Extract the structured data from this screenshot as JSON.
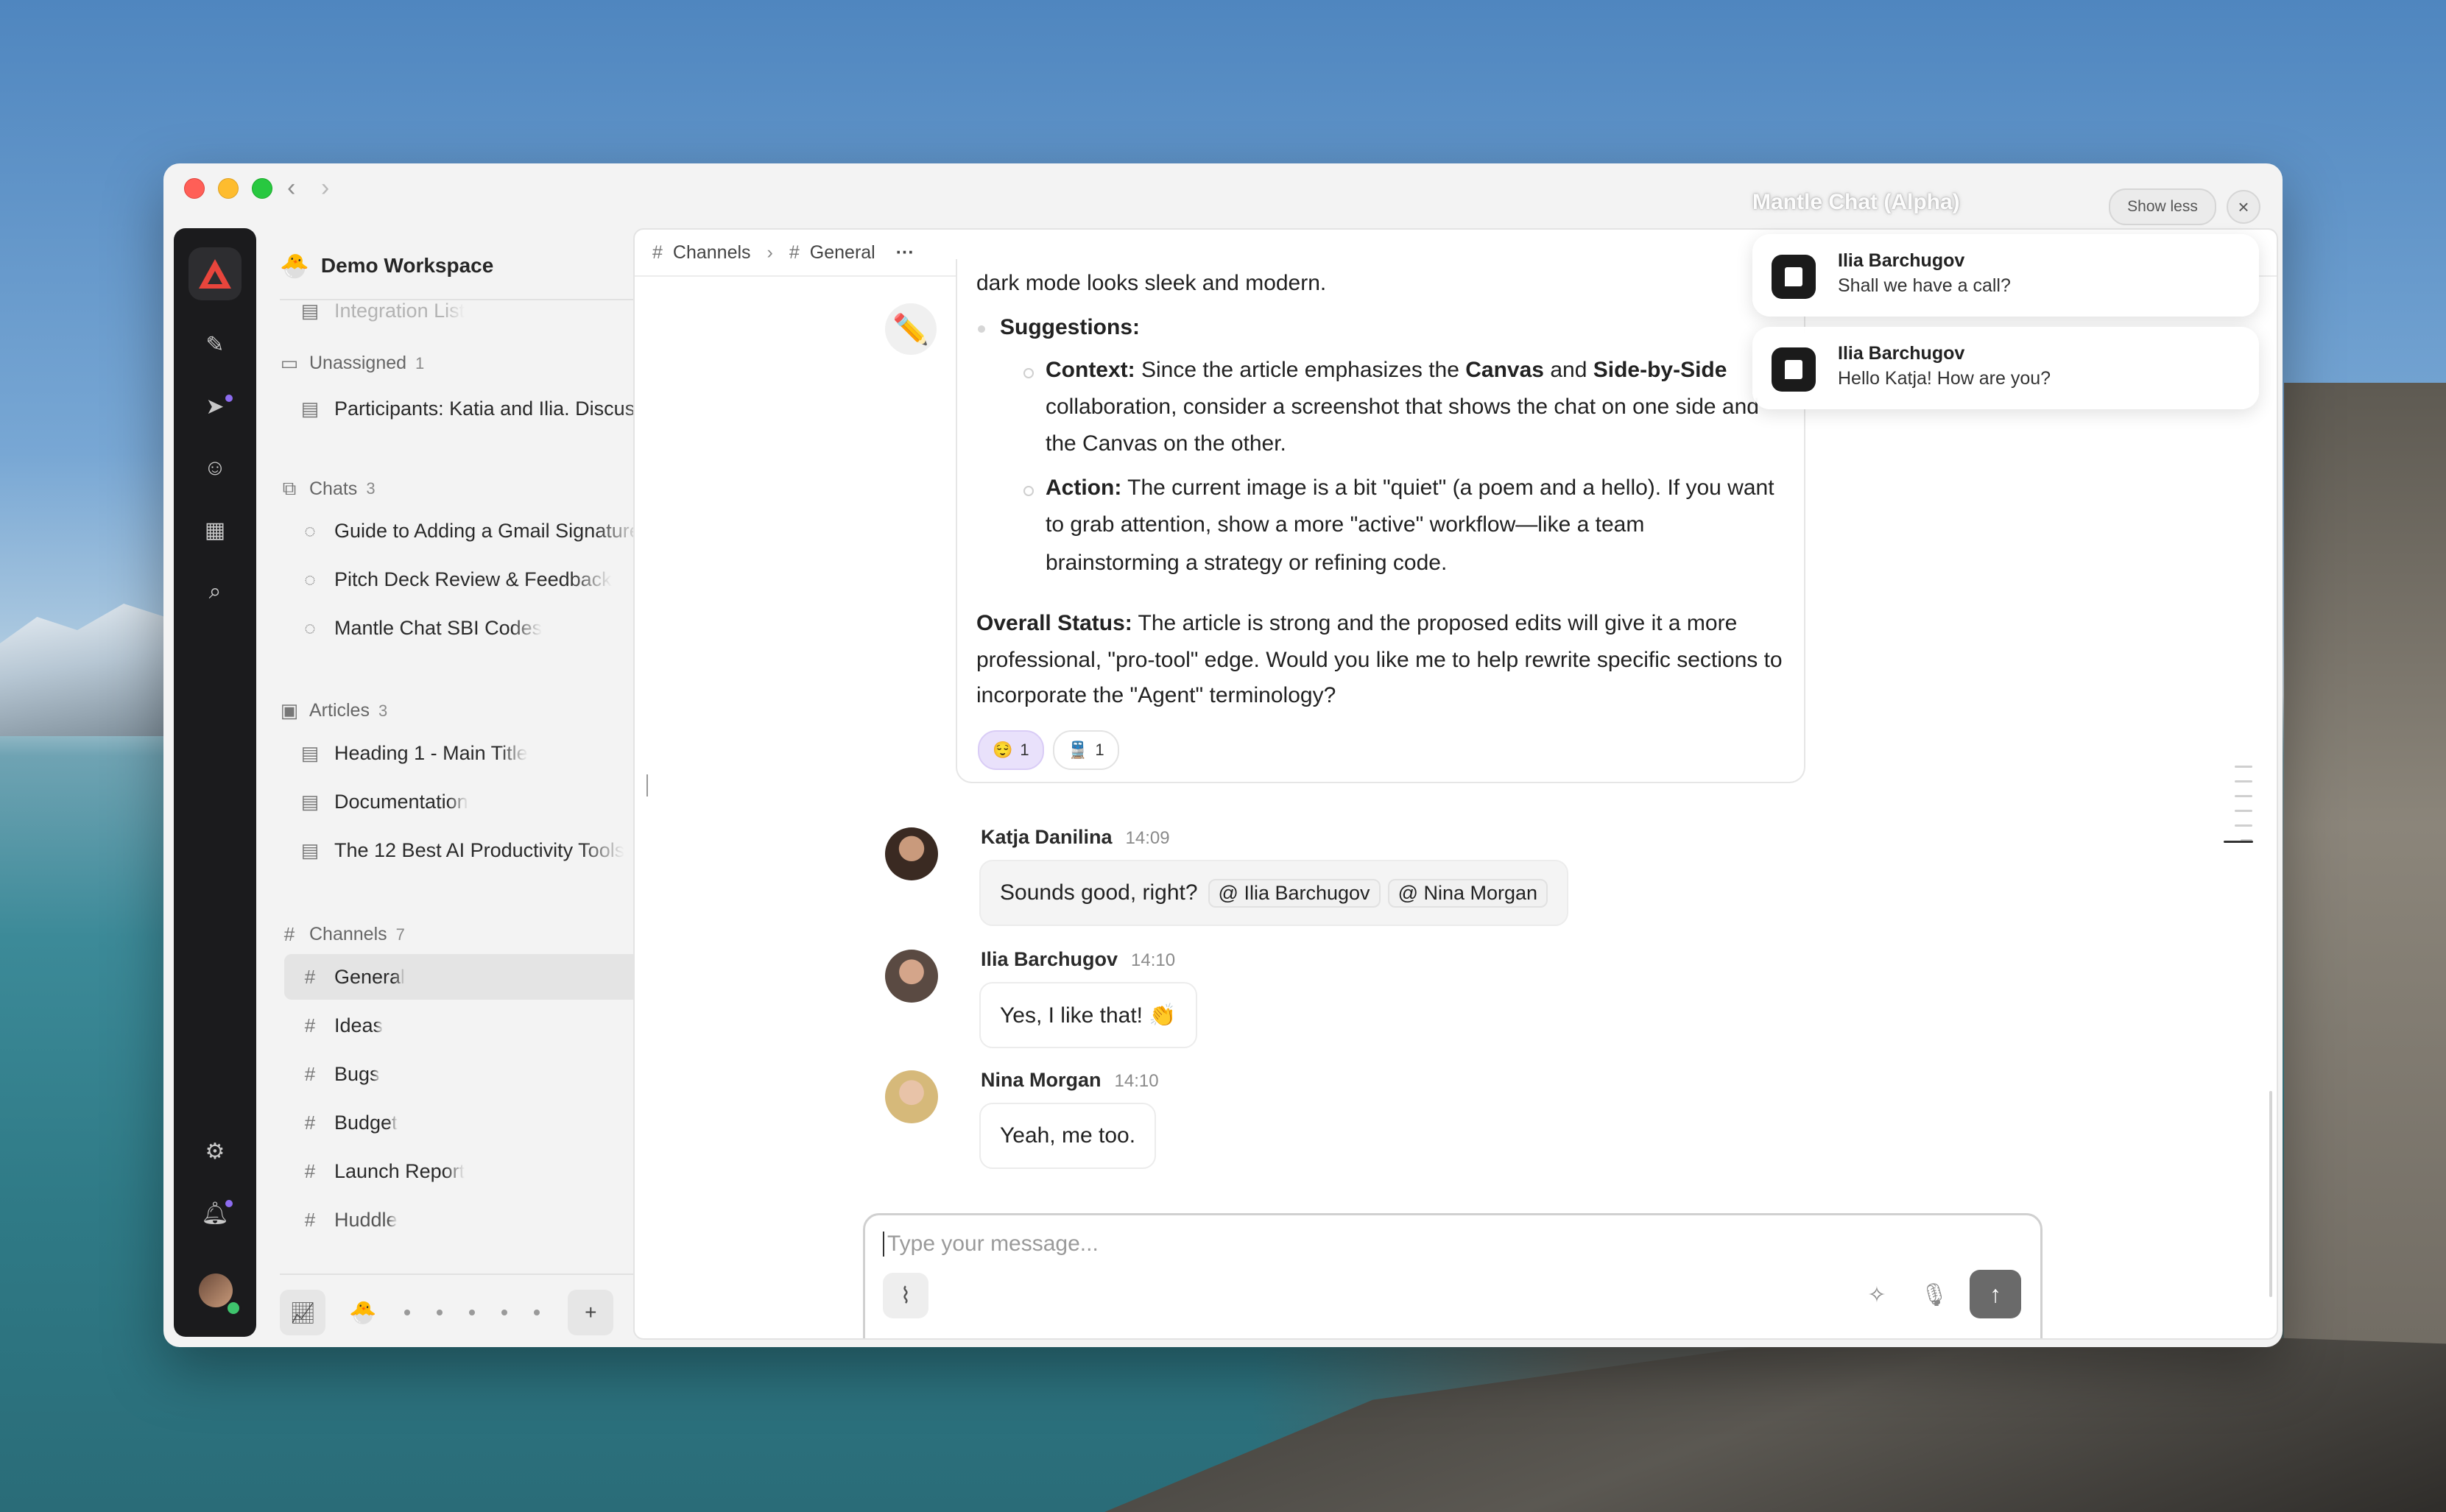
{
  "workspace": {
    "emoji": "🐣",
    "name": "Demo Workspace"
  },
  "sidebar": {
    "faded_item": "Integration List",
    "unassigned": {
      "label": "Unassigned",
      "count": "1",
      "items": [
        "Participants: Katia and Ilia. Discussion"
      ]
    },
    "chats": {
      "label": "Chats",
      "count": "3",
      "items": [
        "Guide to Adding a Gmail Signature",
        "Pitch Deck Review & Feedback",
        "Mantle Chat SBI Codes"
      ]
    },
    "articles": {
      "label": "Articles",
      "count": "3",
      "items": [
        "Heading 1 - Main Title",
        "Documentation",
        "The 12 Best AI Productivity Tools"
      ]
    },
    "channels": {
      "label": "Channels",
      "count": "7",
      "items": [
        "General",
        "Ideas",
        "Bugs",
        "Budget",
        "Launch Report",
        "Huddle"
      ]
    },
    "bottom_emoji": "🐣"
  },
  "breadcrumb": {
    "root": "Channels",
    "current": "General",
    "more": "···"
  },
  "ai_message": {
    "line_top": "dark mode looks sleek and modern.",
    "suggestions_label": "Suggestions:",
    "context_label": "Context:",
    "context_text_1": "Since the article emphasizes the",
    "context_bold_1": "Canvas",
    "context_and": "and",
    "context_bold_2": "Side-by-Side",
    "context_line_2": "collaboration, consider a screenshot that shows the chat on one side and",
    "context_line_3": "the Canvas on the other.",
    "action_label": "Action:",
    "action_line_1": "The current image is a bit \"quiet\" (a poem and a hello). If you want",
    "action_line_2": "to grab attention, show a more \"active\" workflow—like a team",
    "action_line_3": "brainstorming a strategy or refining code.",
    "overall_label": "Overall Status:",
    "overall_line_1": "The article is strong and the proposed edits will give it a more",
    "overall_line_2": "professional, \"pro-tool\" edge. Would you like me to help rewrite specific sections to",
    "overall_line_3": "incorporate the \"Agent\" terminology?",
    "reactions": [
      {
        "emoji": "😌",
        "count": "1"
      },
      {
        "emoji": "🚆",
        "count": "1"
      }
    ]
  },
  "messages": [
    {
      "author": "Katja Danilina",
      "time": "14:09",
      "text": "Sounds good, right?",
      "mentions": [
        "@ Ilia Barchugov",
        "@ Nina Morgan"
      ]
    },
    {
      "author": "Ilia Barchugov",
      "time": "14:10",
      "text": "Yes, I like that! 👏"
    },
    {
      "author": "Nina Morgan",
      "time": "14:10",
      "text": "Yeah, me too."
    }
  ],
  "composer": {
    "placeholder": "Type your message..."
  },
  "notifications": {
    "title": "Mantle Chat (Alpha)",
    "show_less": "Show less",
    "items": [
      {
        "from": "Ilia Barchugov",
        "message": "Shall we have a call?"
      },
      {
        "from": "Ilia Barchugov",
        "message": "Hello Katja! How are you?"
      }
    ]
  },
  "colors": {
    "accent_logo": "#e8453c",
    "notification_dot": "#8d6cf0",
    "online": "#3ec46d"
  }
}
